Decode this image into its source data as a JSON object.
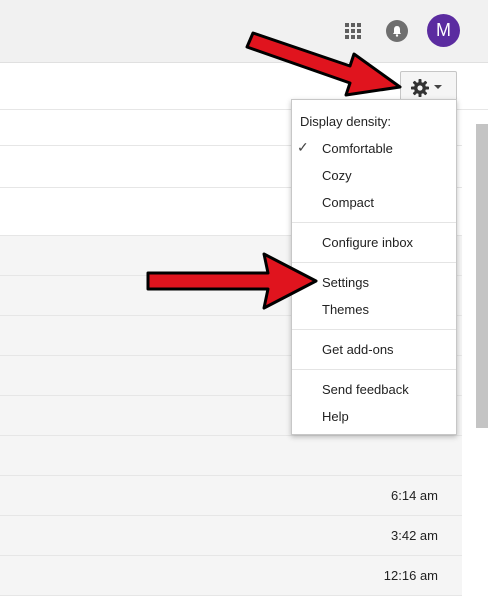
{
  "header": {
    "apps_icon": "apps-grid-icon",
    "notifications_icon": "bell-icon",
    "avatar_letter": "M"
  },
  "toolbar": {
    "settings_icon": "gear-icon",
    "dropdown_icon": "caret-down-icon"
  },
  "menu": {
    "header": "Display density:",
    "items": [
      {
        "label": "Comfortable",
        "checked": true
      },
      {
        "label": "Cozy"
      },
      {
        "label": "Compact"
      },
      {
        "label": "Configure inbox"
      },
      {
        "label": "Settings"
      },
      {
        "label": "Themes"
      },
      {
        "label": "Get add-ons"
      },
      {
        "label": "Send feedback"
      },
      {
        "label": "Help"
      }
    ]
  },
  "email_times": [
    "6:14 am",
    "3:42 am",
    "12:16 am"
  ],
  "colors": {
    "avatar": "#5b2ca0",
    "arrow_fill": "#e0141e",
    "arrow_outline": "#000000"
  }
}
